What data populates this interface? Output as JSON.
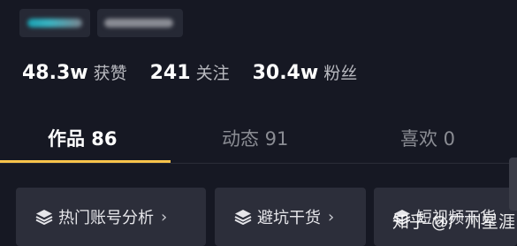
{
  "profile": {
    "stats": [
      {
        "value": "48.3w",
        "label": "获赞"
      },
      {
        "value": "241",
        "label": "关注"
      },
      {
        "value": "30.4w",
        "label": "粉丝"
      }
    ]
  },
  "tabs": [
    {
      "label": "作品 86",
      "active": true
    },
    {
      "label": "动态 91",
      "active": false
    },
    {
      "label": "喜欢 0",
      "active": false
    }
  ],
  "chips": [
    {
      "icon": "stack-icon",
      "label": "热门账号分析"
    },
    {
      "icon": "stack-icon",
      "label": "避坑干货"
    },
    {
      "icon": "stack-icon",
      "label": "短视频干货"
    }
  ],
  "chevron": "›",
  "watermark": "知乎 @广州星涯",
  "colors": {
    "background": "#161823",
    "accent_underline": "#f8c34b",
    "chip_bg": "#2c2e3a"
  }
}
